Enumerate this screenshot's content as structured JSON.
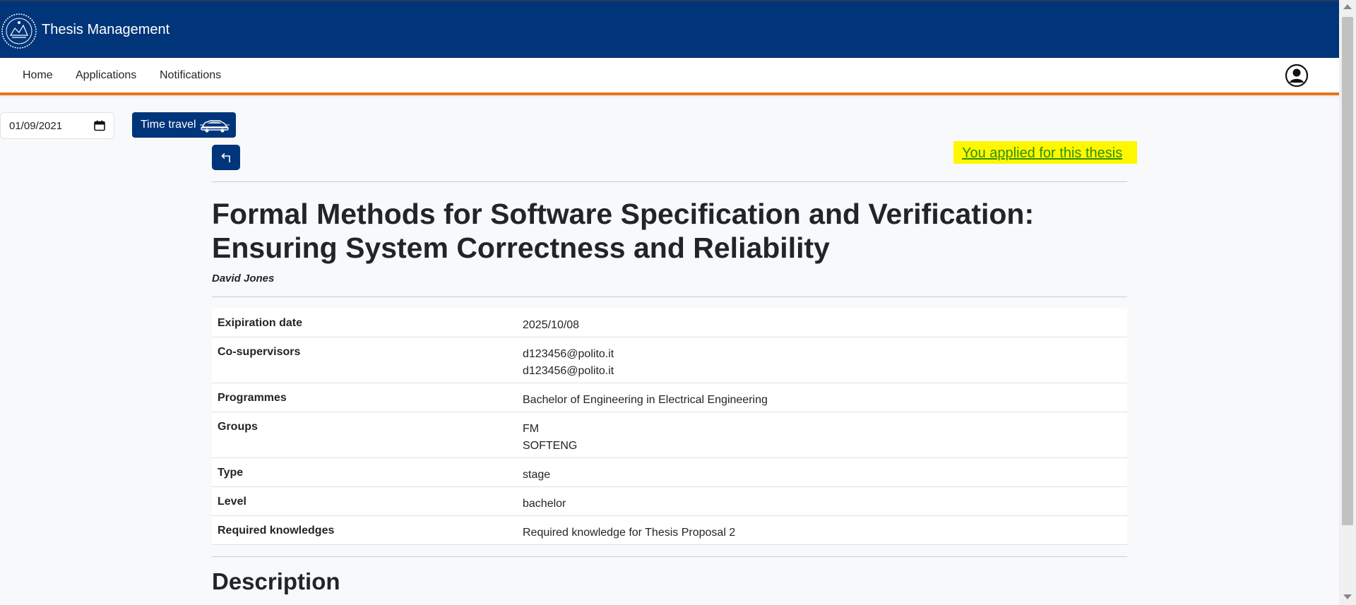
{
  "header": {
    "app_title": "Thesis Management",
    "logo_icon": "university-seal-icon",
    "brand_color": "#00357a",
    "accent_color": "#e8731a"
  },
  "nav": {
    "items": [
      {
        "label": "Home"
      },
      {
        "label": "Applications"
      },
      {
        "label": "Notifications"
      }
    ],
    "account_icon": "user-circle-icon"
  },
  "toolbar": {
    "date_value": "01/09/2021",
    "time_travel_label": "Time travel",
    "time_travel_icon": "car-icon",
    "back_icon": "back-arrow-icon"
  },
  "status": {
    "applied_label": "You applied for this thesis",
    "highlight_color": "#fff700",
    "text_color": "#2e8f0d"
  },
  "thesis": {
    "title": "Formal Methods for Software Specification and Verification: Ensuring System Correctness and Reliability",
    "supervisor": "David Jones",
    "details": [
      {
        "label": "Exipiration date",
        "values": [
          "2025/10/08"
        ]
      },
      {
        "label": "Co-supervisors",
        "values": [
          "d123456@polito.it",
          "d123456@polito.it"
        ]
      },
      {
        "label": "Programmes",
        "values": [
          "Bachelor of Engineering in Electrical Engineering"
        ]
      },
      {
        "label": "Groups",
        "values": [
          "FM",
          "SOFTENG"
        ]
      },
      {
        "label": "Type",
        "values": [
          "stage"
        ]
      },
      {
        "label": "Level",
        "values": [
          "bachelor"
        ]
      },
      {
        "label": "Required knowledges",
        "values": [
          "Required knowledge for Thesis Proposal 2"
        ]
      }
    ],
    "description_heading": "Description"
  }
}
